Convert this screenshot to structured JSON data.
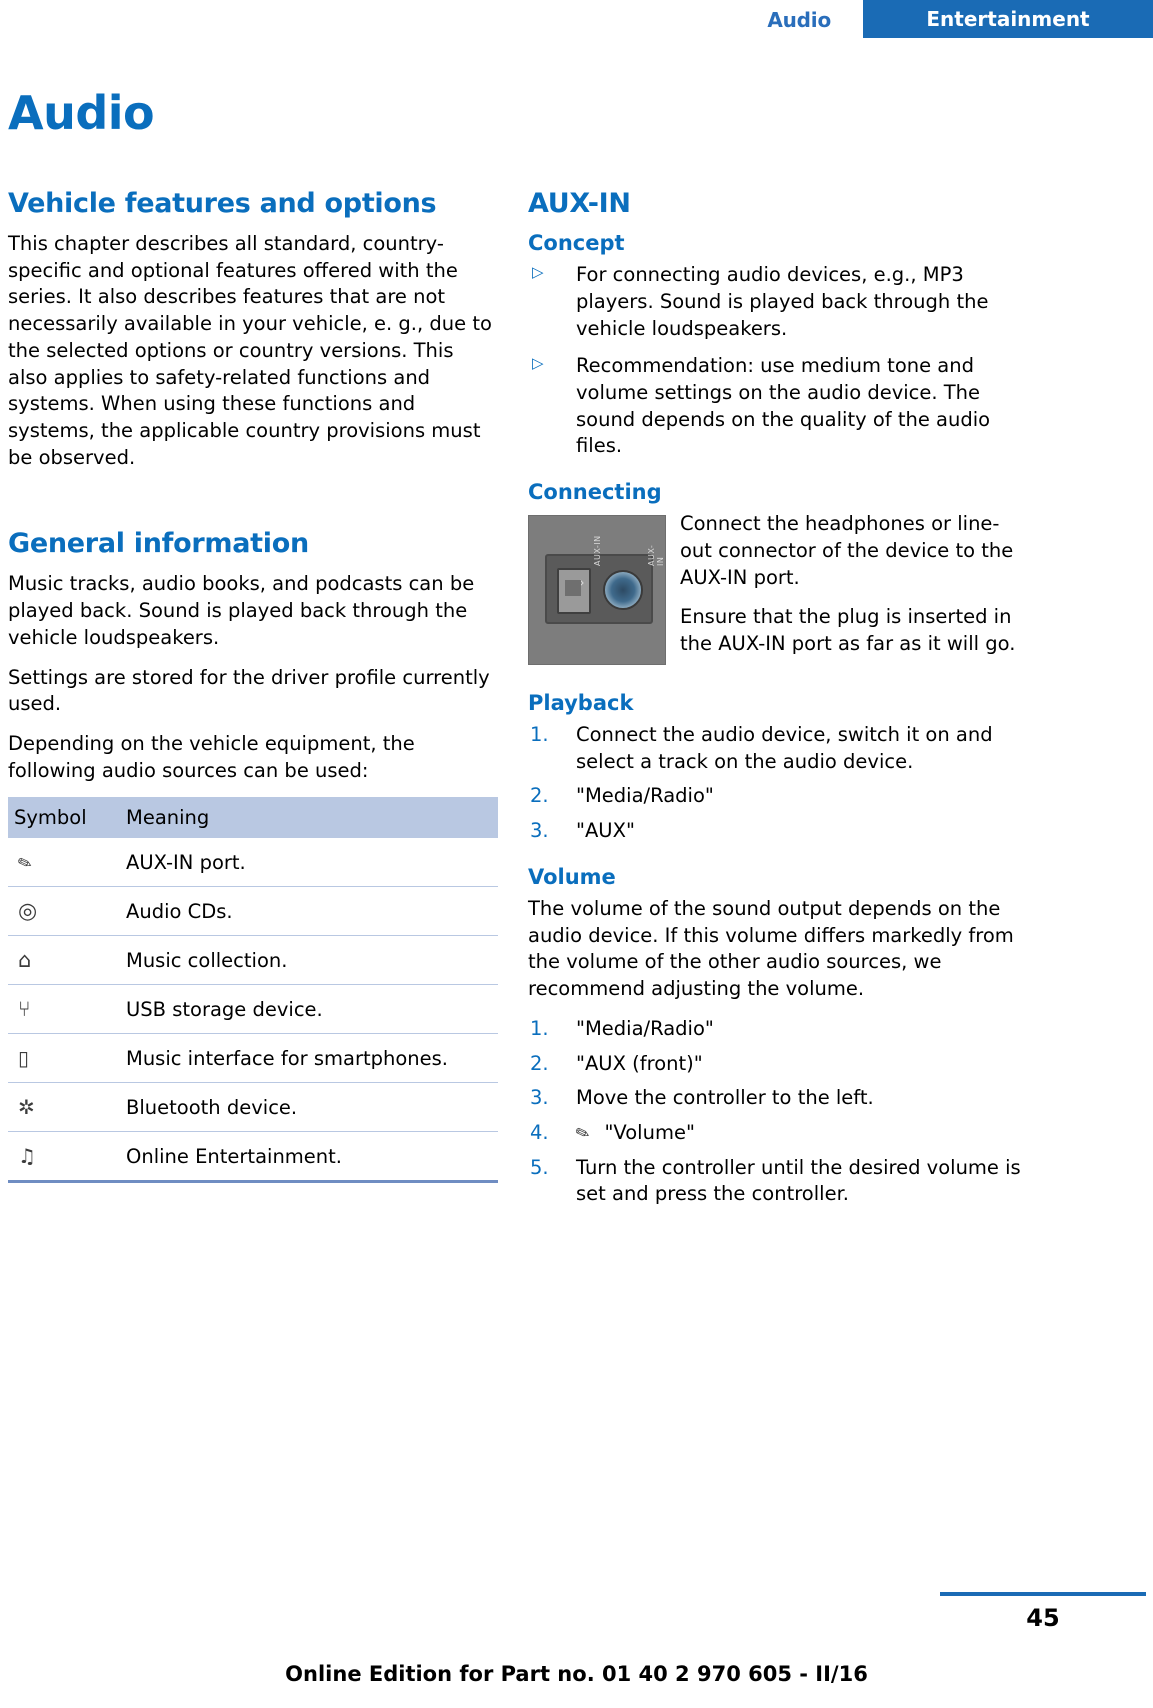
{
  "header": {
    "breadcrumb_section": "Audio",
    "tab_label": "Entertainment",
    "accent_color": "#1a6bb5"
  },
  "page_title": "Audio",
  "left_column": {
    "section1_heading": "Vehicle features and options",
    "section1_body": "This chapter describes all standard, country-specific and optional features offered with the series. It also describes features that are not necessarily available in your vehicle, e. g., due to the selected options or country versions. This also applies to safety-related functions and systems. When using these functions and systems, the applicable country provisions must be observed.",
    "section2_heading": "General information",
    "section2_para1": "Music tracks, audio books, and podcasts can be played back. Sound is played back through the vehicle loudspeakers.",
    "section2_para2": "Settings are stored for the driver profile currently used.",
    "section2_para3": "Depending on the vehicle equipment, the following audio sources can be used:",
    "table": {
      "headers": [
        "Symbol",
        "Meaning"
      ],
      "rows": [
        {
          "icon": "aux-plug-icon",
          "glyph": "✎",
          "meaning": "AUX-IN port."
        },
        {
          "icon": "cd-disc-icon",
          "glyph": "◎",
          "meaning": "Audio CDs."
        },
        {
          "icon": "music-collection-icon",
          "glyph": "⌂",
          "meaning": "Music collection."
        },
        {
          "icon": "usb-icon",
          "glyph": "⑂",
          "meaning": "USB storage device."
        },
        {
          "icon": "smartphone-icon",
          "glyph": "▯",
          "meaning": "Music interface for smartphones."
        },
        {
          "icon": "bluetooth-icon",
          "glyph": "✲",
          "meaning": "Bluetooth device."
        },
        {
          "icon": "online-entertainment-icon",
          "glyph": "♫",
          "meaning": "Online Entertainment."
        }
      ]
    }
  },
  "right_column": {
    "section_heading": "AUX-IN",
    "concept_heading": "Concept",
    "concept_bullets": [
      "For connecting audio devices, e.g., MP3 players. Sound is played back through the vehicle loudspeakers.",
      "Recommendation: use medium tone and volume settings on the audio device. The sound depends on the quality of the audio files."
    ],
    "connecting_heading": "Connecting",
    "connecting_para1": "Connect the headphones or line-out connector of the device to the AUX-IN port.",
    "connecting_para2": "Ensure that the plug is inserted in the AUX-IN port as far as it will go.",
    "figure": {
      "name": "aux-in-port-photo",
      "label_left": "AUX-IN",
      "label_right": "AUX-IN"
    },
    "playback_heading": "Playback",
    "playback_steps": [
      {
        "num": "1.",
        "text": "Connect the audio device, switch it on and select a track on the audio device."
      },
      {
        "num": "2.",
        "text": "\"Media/Radio\""
      },
      {
        "num": "3.",
        "text": "\"AUX\""
      }
    ],
    "volume_heading": "Volume",
    "volume_para": "The volume of the sound output depends on the audio device. If this volume differs markedly from the volume of the other audio sources, we recommend adjusting the volume.",
    "volume_steps": [
      {
        "num": "1.",
        "text": "\"Media/Radio\""
      },
      {
        "num": "2.",
        "text": "\"AUX (front)\""
      },
      {
        "num": "3.",
        "text": "Move the controller to the left."
      },
      {
        "num": "4.",
        "text": "\"Volume\"",
        "icon": "aux-plug-icon",
        "glyph": "✎"
      },
      {
        "num": "5.",
        "text": "Turn the controller until the desired volume is set and press the controller."
      }
    ]
  },
  "footer": {
    "page_number": "45",
    "online_edition": "Online Edition for Part no. 01 40 2 970 605 - II/16"
  }
}
